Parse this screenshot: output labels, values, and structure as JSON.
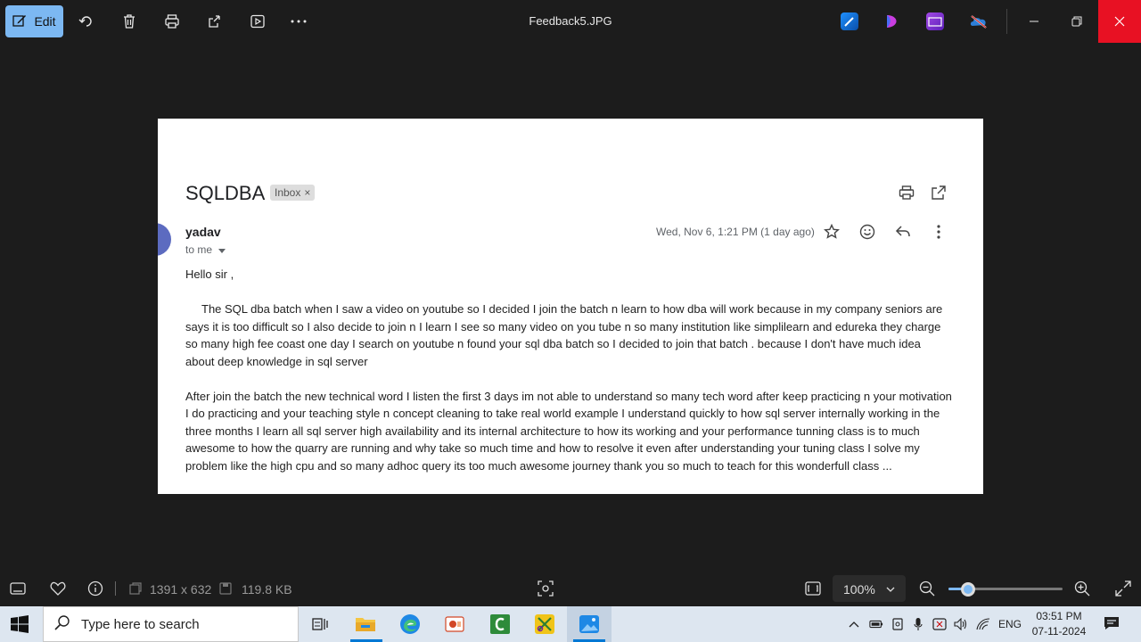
{
  "titlebar": {
    "edit_label": "Edit",
    "file_name": "Feedback5.JPG"
  },
  "email": {
    "subject": "SQLDBA",
    "label_badge": "Inbox",
    "badge_close": "×",
    "sender": "yadav",
    "to": "to me",
    "date": "Wed, Nov 6, 1:21 PM (1 day ago)",
    "greeting": "Hello sir ,",
    "para1": "The SQL  dba batch when I saw a video on youtube so I decided I join the batch n learn to how dba will work because in my company seniors are says it is too difficult so I also decide to join n I learn I see so many video on you tube n so many institution like simplilearn and edureka they charge so many high fee coast one day I search on youtube n found your sql dba batch so I decided to join that batch . because I don't have much idea about deep knowledge in sql server",
    "para2": "After join the batch the new technical word I listen the first 3 days im not able to understand so many tech word after keep practicing n your motivation I do practicing and your teaching style n concept cleaning to take real world example I understand quickly to how sql server internally working in the three months I learn all sql server high availability and its internal architecture to how its working and your performance tunning  class is to much awesome to how the quarry are running and why take so much time and how to resolve it even after understanding your tuning class I solve my problem like the high cpu and so many adhoc query its too much awesome journey thank you so much to teach for this wonderfull class ..."
  },
  "bottombar": {
    "dimensions": "1391 x 632",
    "file_size": "119.8 KB",
    "zoom": "100%",
    "zoom_level_percent": 17
  },
  "taskbar": {
    "search_placeholder": "Type here to search",
    "language": "ENG",
    "time": "03:51 PM",
    "date": "07-11-2024"
  },
  "colors": {
    "accent": "#7cb8f2",
    "close_red": "#e81123",
    "avatar": "#5c6bc0"
  }
}
